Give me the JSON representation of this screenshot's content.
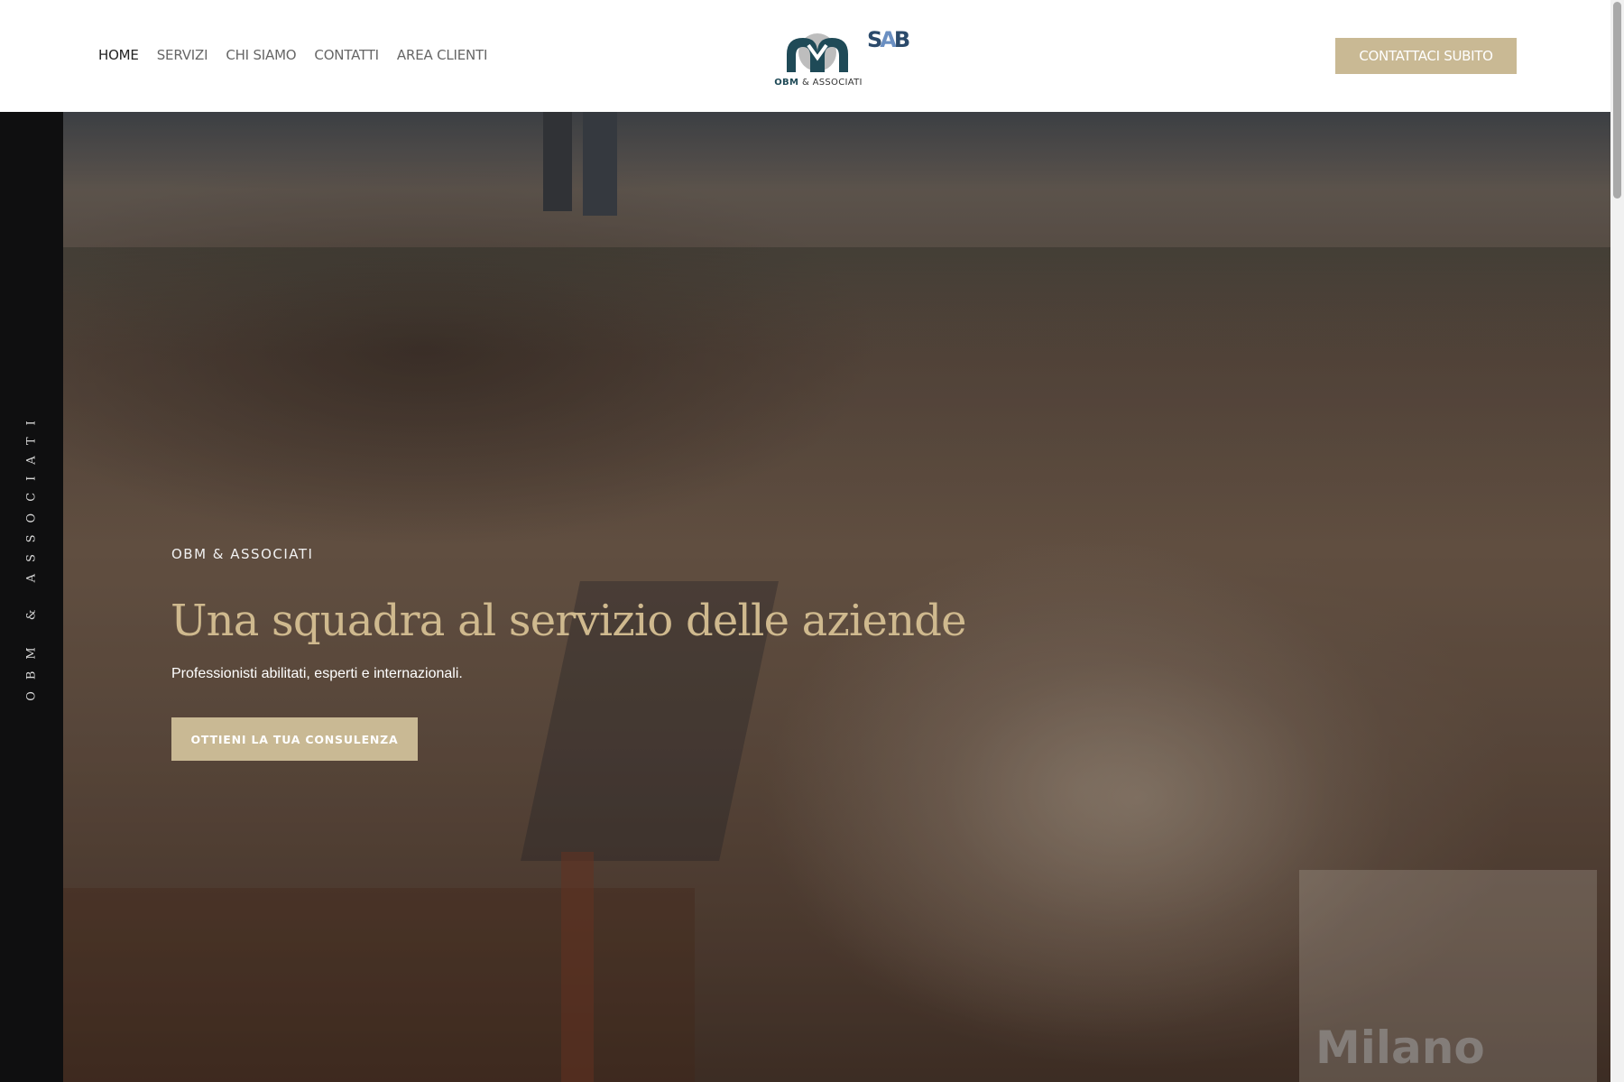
{
  "nav": {
    "items": [
      {
        "label": "HOME",
        "active": true
      },
      {
        "label": "SERVIZI"
      },
      {
        "label": "CHI SIAMO"
      },
      {
        "label": "CONTATTI"
      },
      {
        "label": "AREA CLIENTI"
      }
    ]
  },
  "logo": {
    "name_part1": "OBM",
    "name_part2": "& ASSOCIATI",
    "partner_p1": "S",
    "partner_p2": "A",
    "partner_p3": "B"
  },
  "header": {
    "cta_label": "CONTATTACI SUBITO"
  },
  "sidebar": {
    "vertical_text": "OBM & ASSOCIATI"
  },
  "hero": {
    "eyebrow": "OBM & ASSOCIATI",
    "title": "Una squadra al servizio delle aziende",
    "subtitle": "Professionisti abilitati, esperti e internazionali.",
    "button_label": "OTTIENI LA TUA CONSULENZA",
    "watermark": "Milano"
  },
  "colors": {
    "accent": "#c9b994",
    "title_gold": "#cfb98e",
    "logo_teal": "#1f4a57",
    "sidebar_bg": "#0f0f10"
  }
}
